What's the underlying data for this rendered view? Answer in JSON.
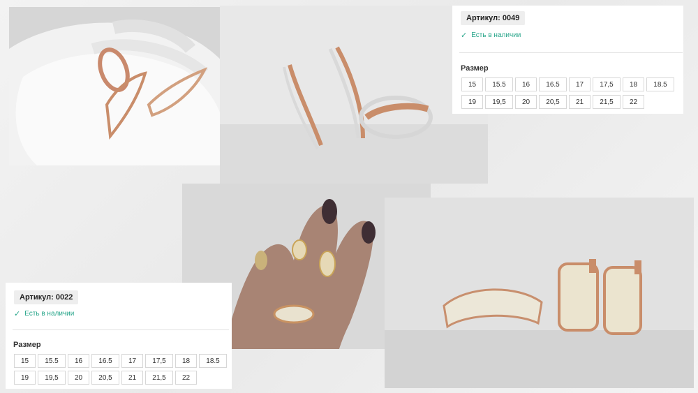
{
  "card_top": {
    "sku": "Артикул: 0049",
    "stock": "Есть в наличии",
    "size_title": "Размер",
    "sizes_row1": [
      "15",
      "15.5",
      "16",
      "16.5",
      "17",
      "17,5",
      "18",
      "18.5"
    ],
    "sizes_row2": [
      "19",
      "19,5",
      "20",
      "20,5",
      "21",
      "21,5",
      "22"
    ]
  },
  "card_bottom": {
    "sku": "Артикул: 0022",
    "stock": "Есть в наличии",
    "size_title": "Размер",
    "sizes_row1": [
      "15",
      "15.5",
      "16",
      "16.5",
      "17",
      "17,5",
      "18",
      "18.5"
    ],
    "sizes_row2": [
      "19",
      "19,5",
      "20",
      "20,5",
      "21",
      "21,5",
      "22"
    ]
  },
  "icons": {
    "stock_check": "check-icon"
  },
  "colors": {
    "stock_green": "#27a58a",
    "gold": "#c98d6a",
    "silver": "#d9d9d9"
  }
}
